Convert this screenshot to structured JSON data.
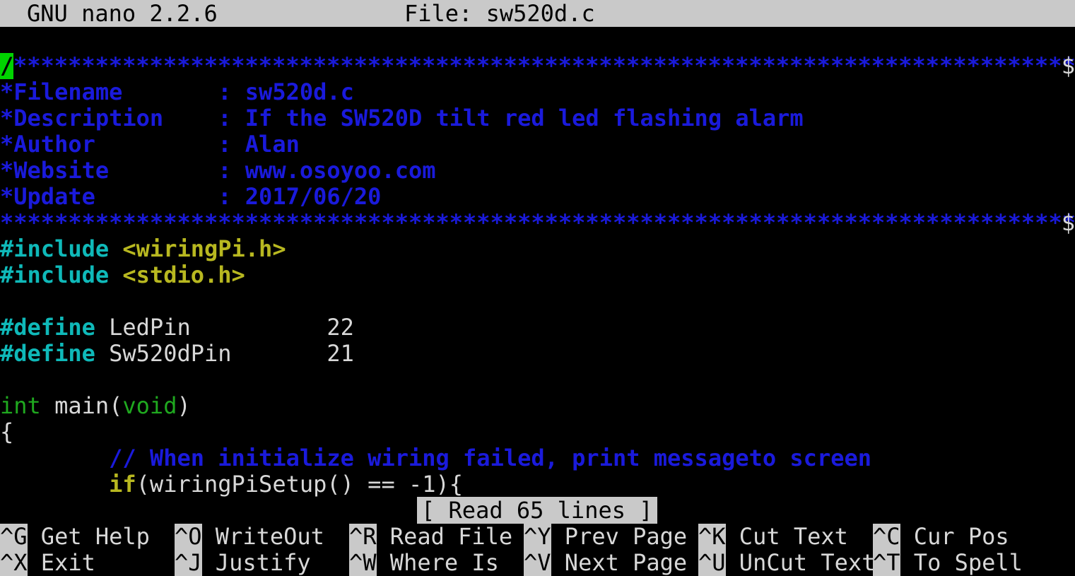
{
  "titlebar": {
    "version": "GNU nano 2.2.6",
    "file": "File: sw520d.c"
  },
  "editor": {
    "cursor_char": "/",
    "line1_stars": "************************************************************************************",
    "line_end_marker": "$",
    "header": [
      {
        "key": "*Filename       ",
        "value": ": sw520d.c"
      },
      {
        "key": "*Description    ",
        "value": ": If the SW520D tilt red led flashing alarm"
      },
      {
        "key": "*Author         ",
        "value": ": Alan"
      },
      {
        "key": "*Website        ",
        "value": ": www.osoyoo.com"
      },
      {
        "key": "*Update         ",
        "value": ": 2017/06/20"
      }
    ],
    "line7_stars": "*************************************************************************************",
    "includes": [
      {
        "directive": "#include",
        "file": "<wiringPi.h>"
      },
      {
        "directive": "#include",
        "file": "<stdio.h>"
      }
    ],
    "defines": [
      {
        "directive": "#define",
        "rest": " LedPin          22"
      },
      {
        "directive": "#define",
        "rest": " Sw520dPin       21"
      }
    ],
    "main_type": "int",
    "main_name": " main(",
    "main_arg": "void",
    "main_close": ")",
    "brace_open": "{",
    "indent": "        ",
    "comment_line": "// When initialize wiring failed, print messageto screen",
    "if_kw": "if",
    "if_rest": "(wiringPiSetup() == -1){"
  },
  "status": {
    "message": "[ Read 65 lines ]"
  },
  "shortcuts": [
    {
      "key": "^G",
      "label": " Get Help"
    },
    {
      "key": "^O",
      "label": " WriteOut"
    },
    {
      "key": "^R",
      "label": " Read File"
    },
    {
      "key": "^Y",
      "label": " Prev Page"
    },
    {
      "key": "^K",
      "label": " Cut Text"
    },
    {
      "key": "^C",
      "label": " Cur Pos"
    },
    {
      "key": "^X",
      "label": " Exit"
    },
    {
      "key": "^J",
      "label": " Justify"
    },
    {
      "key": "^W",
      "label": " Where Is"
    },
    {
      "key": "^V",
      "label": " Next Page"
    },
    {
      "key": "^U",
      "label": " UnCut Text"
    },
    {
      "key": "^T",
      "label": " To Spell"
    }
  ],
  "colors": {
    "comment": "#1a1adb",
    "preprocessor": "#0fb9b9",
    "include_file": "#b8b820",
    "type_keyword": "#1fa81f",
    "cursor": "#00d400",
    "bar": "#c9c9c9"
  }
}
